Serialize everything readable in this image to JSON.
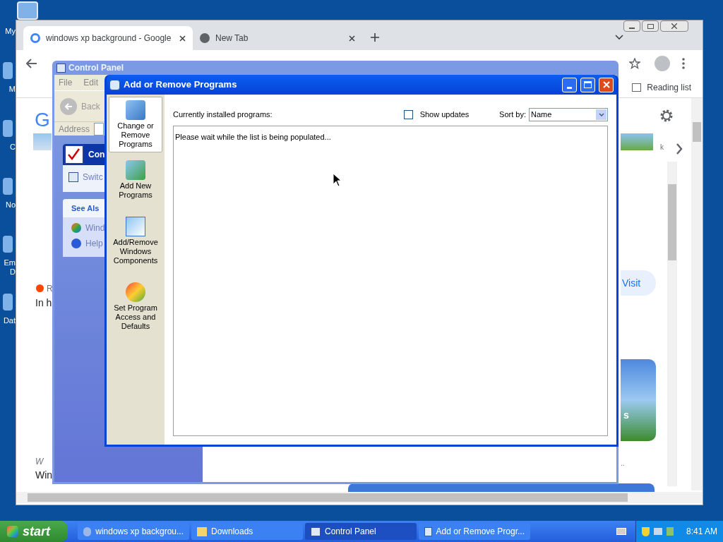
{
  "desktop_icons": [
    {
      "lines": [
        "My"
      ]
    },
    {
      "lines": [
        "M"
      ]
    },
    {
      "lines": [
        "C"
      ]
    },
    {
      "lines": [
        "No"
      ]
    },
    {
      "lines": [
        "Em",
        "D"
      ]
    },
    {
      "lines": [
        "Dat"
      ]
    }
  ],
  "browser": {
    "tabs": [
      {
        "label": "windows xp background - Google",
        "selected": true
      },
      {
        "label": "New Tab",
        "selected": false
      }
    ],
    "reading_list": "Reading list",
    "logo": "G",
    "result_source": "R",
    "result_title": "In h",
    "visit": "Visit",
    "thumb_caption": "k",
    "wiki_source": "W",
    "wiki_title": "Win",
    "ellipsis": "..",
    "image_caption": "s"
  },
  "control_panel": {
    "title": "Control Panel",
    "menu": [
      "File",
      "Edit"
    ],
    "back": "Back",
    "address_label": "Address",
    "pane_title": "Con",
    "pane_link": "Switc",
    "see_also_title": "See Als",
    "see_also": [
      {
        "kind": "windows",
        "label": "Wind"
      },
      {
        "kind": "help",
        "label": "Help"
      }
    ]
  },
  "add_remove": {
    "title": "Add or Remove Programs",
    "sidebar": [
      {
        "kind": "change",
        "label": "Change or Remove Programs",
        "selected": true
      },
      {
        "kind": "add",
        "label": "Add New Programs",
        "selected": false
      },
      {
        "kind": "components",
        "label": "Add/Remove Windows Components",
        "selected": false
      },
      {
        "kind": "access",
        "label": "Set Program Access and Defaults",
        "selected": false
      }
    ],
    "list_label": "Currently installed programs:",
    "show_updates": {
      "label": "Show updates",
      "checked": false
    },
    "sort_label": "Sort by:",
    "sort_value": "Name",
    "status": "Please wait while the list is being populated..."
  },
  "taskbar": {
    "start": "start",
    "tasks": [
      {
        "kind": "browser",
        "label": "windows xp backgrou...",
        "selected": false
      },
      {
        "kind": "folder",
        "label": "Downloads",
        "selected": false
      },
      {
        "kind": "control",
        "label": "Control Panel",
        "selected": true
      },
      {
        "kind": "programs",
        "label": "Add or Remove Progr...",
        "selected": false
      }
    ],
    "clock": "8:41 AM"
  }
}
